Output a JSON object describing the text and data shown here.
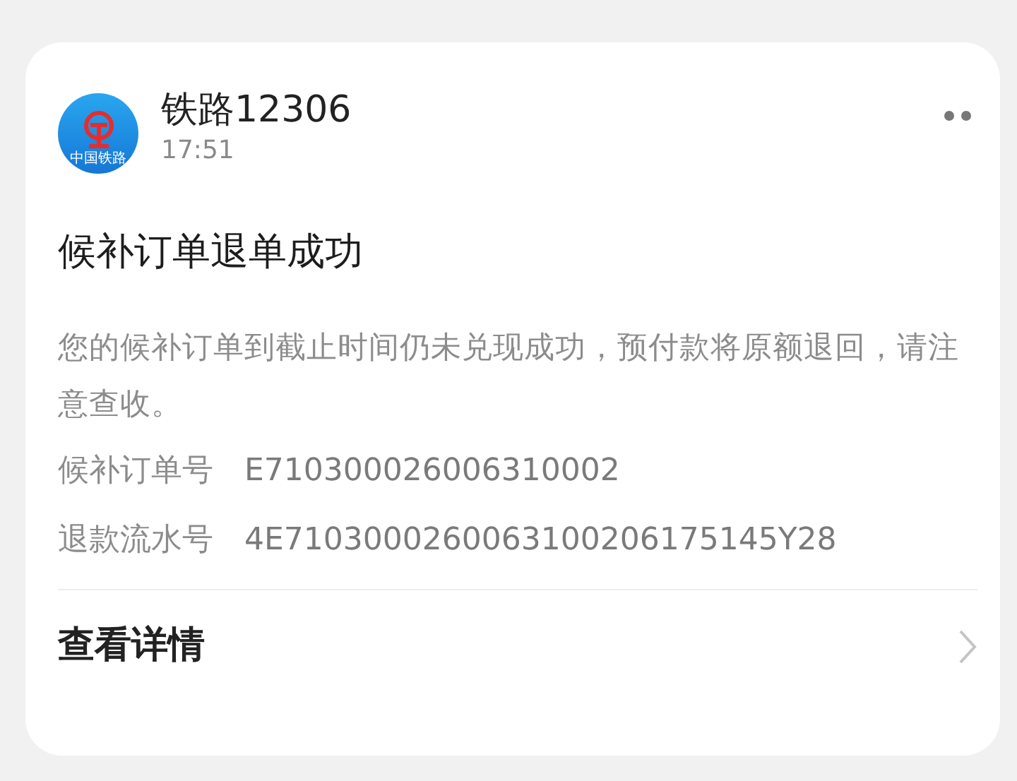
{
  "notification": {
    "app": {
      "logo_text": "中国铁路",
      "name": "铁路12306",
      "time": "17:51"
    },
    "title": "候补订单退单成功",
    "message": "您的候补订单到截止时间仍未兑现成功，预付款将原额退回，请注意查收。",
    "fields": [
      {
        "label": "候补订单号",
        "value": "E710300026006310002"
      },
      {
        "label": "退款流水号",
        "value": "4E7103000260063100206175145Y28"
      }
    ],
    "action": "查看详情"
  }
}
